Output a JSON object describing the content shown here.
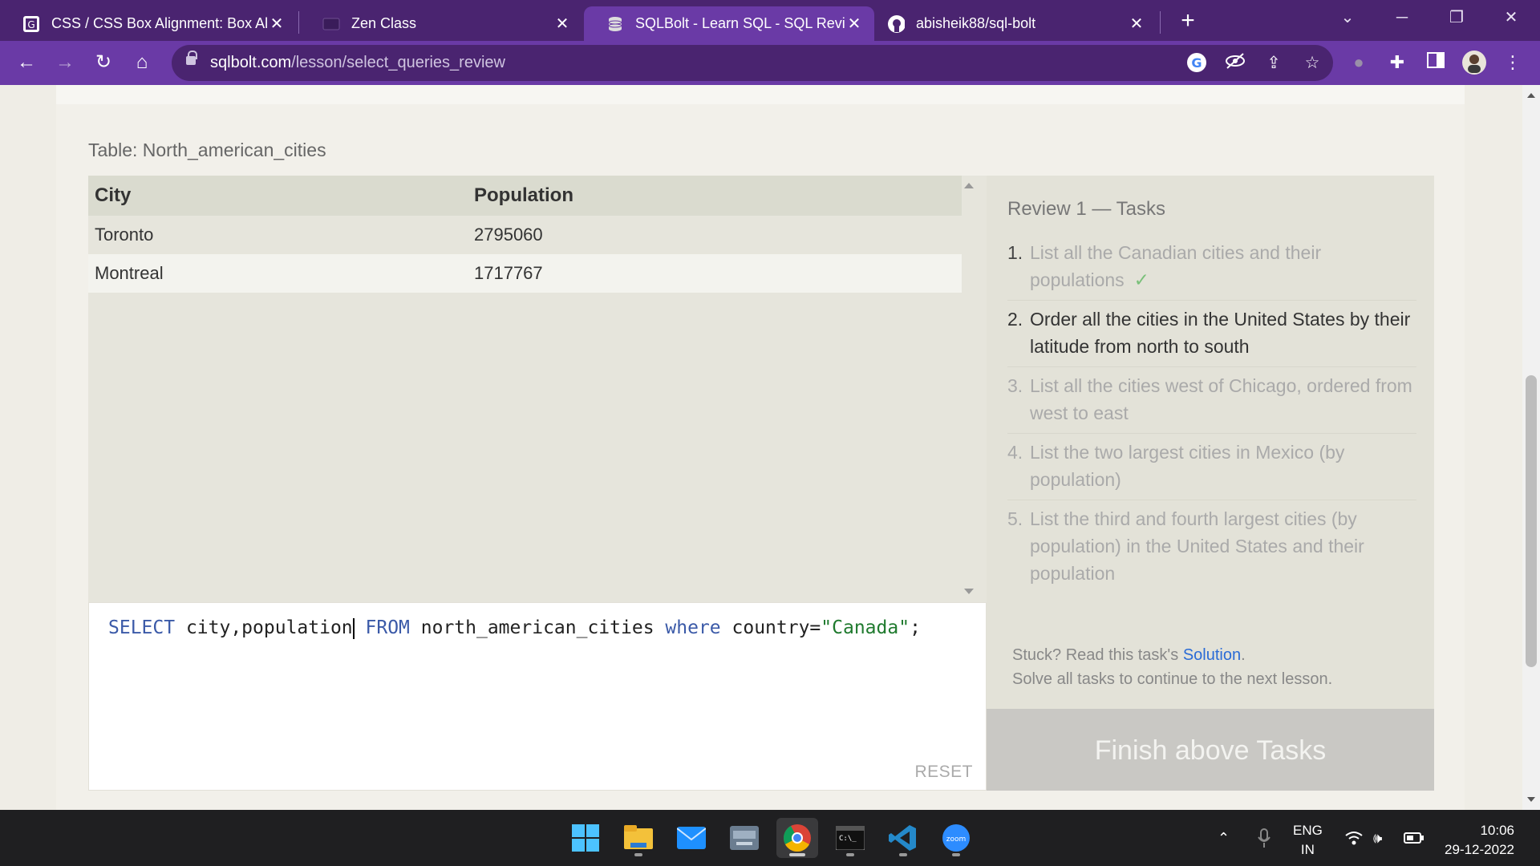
{
  "browser": {
    "tabs": [
      {
        "title": "CSS / CSS Box Alignment: Box Ali",
        "icon": "mdn-favicon"
      },
      {
        "title": "Zen Class",
        "icon": "zen-favicon"
      },
      {
        "title": "SQLBolt - Learn SQL - SQL Review",
        "icon": "database-favicon"
      },
      {
        "title": "abisheik88/sql-bolt",
        "icon": "github-favicon"
      }
    ],
    "active_tab": 2,
    "url_domain": "sqlbolt.com",
    "url_path": "/lesson/select_queries_review"
  },
  "page": {
    "table_caption": "Table: North_american_cities",
    "results": {
      "columns": [
        "City",
        "Population"
      ],
      "rows": [
        [
          "Toronto",
          "2795060"
        ],
        [
          "Montreal",
          "1717767"
        ]
      ]
    },
    "editor": {
      "query": {
        "kw_select": "SELECT",
        "cols": " city,population",
        "kw_from": "FROM",
        "table": " north_american_cities ",
        "kw_where": "where",
        "cond": " country=",
        "str": "\"Canada\"",
        "end": ";"
      },
      "reset_label": "RESET"
    },
    "tasks": {
      "title": "Review 1 — Tasks",
      "items": [
        {
          "num": "1.",
          "text": "List all the Canadian cities and their populations",
          "status": "done",
          "mark": "✓"
        },
        {
          "num": "2.",
          "text": "Order all the cities in the United States by their latitude from north to south",
          "status": "current"
        },
        {
          "num": "3.",
          "text": "List all the cities west of Chicago, ordered from west to east",
          "status": "pending"
        },
        {
          "num": "4.",
          "text": "List the two largest cities in Mexico (by population)",
          "status": "pending"
        },
        {
          "num": "5.",
          "text": "List the third and fourth largest cities (by population) in the United States and their population",
          "status": "pending"
        }
      ],
      "stuck_prefix": "Stuck? Read this task's ",
      "solution_link": "Solution",
      "stuck_suffix": ".",
      "continue_text": "Solve all tasks to continue to the next lesson.",
      "finish_button": "Finish above Tasks"
    }
  },
  "taskbar": {
    "apps": [
      "windows-start",
      "file-explorer",
      "mail",
      "keyboard-app",
      "chrome",
      "terminal",
      "vscode",
      "zoom"
    ],
    "lang_top": "ENG",
    "lang_bottom": "IN",
    "time": "10:06",
    "date": "29-12-2022"
  },
  "colors": {
    "tabstrip": "#4a2470",
    "toolbar": "#6a3aa6",
    "keyword": "#3b5aa8",
    "string": "#1f7a2e",
    "link": "#2a6bd6",
    "check": "#7ac07a"
  }
}
